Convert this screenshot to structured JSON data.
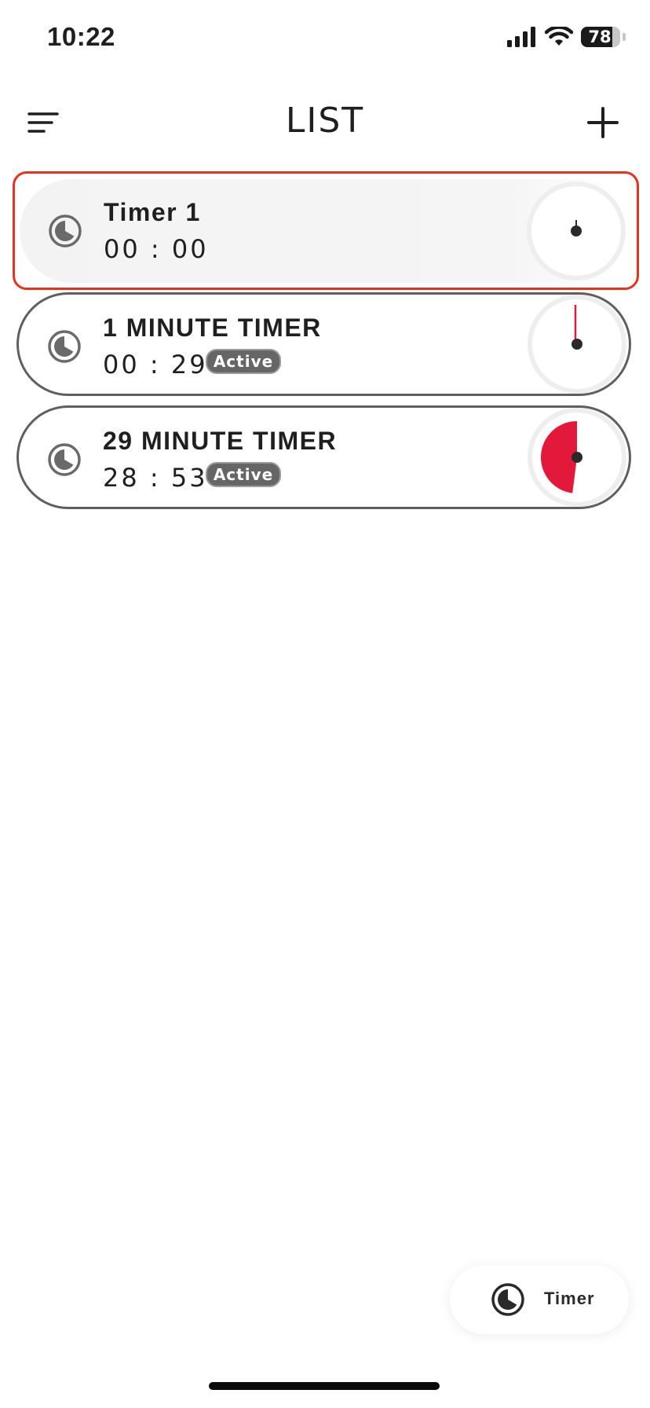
{
  "status_bar": {
    "time": "10:22",
    "battery": "78"
  },
  "header": {
    "title": "LIST",
    "menu_icon": "menu-icon",
    "add_icon": "plus-icon"
  },
  "timers": [
    {
      "title": "Timer 1",
      "time": "00 : 00",
      "status": "",
      "selected": true,
      "progress": 0
    },
    {
      "title": "1 MINUTE TIMER",
      "time": "00 : 29",
      "status": "Active",
      "selected": false,
      "progress": 0.008
    },
    {
      "title": "29 MINUTE TIMER",
      "time": "28 : 53",
      "status": "Active",
      "selected": false,
      "progress": 0.48
    }
  ],
  "fab": {
    "label": "Timer",
    "icon": "timer-icon"
  },
  "colors": {
    "accent_red": "#e3193b",
    "selection_outline": "#e8321e",
    "badge_bg": "#666666"
  }
}
